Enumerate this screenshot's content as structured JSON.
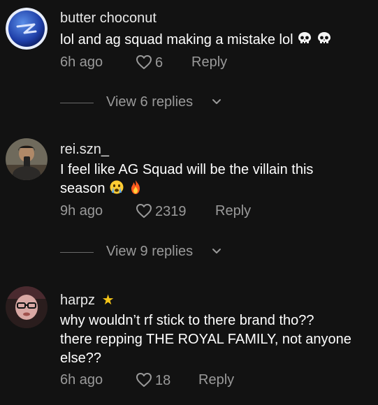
{
  "comments": [
    {
      "username": "butter choconut",
      "text": "lol and ag squad making a mistake lol",
      "time": "6h ago",
      "likes": "6",
      "reply_label": "Reply",
      "view_replies": "View 6 replies",
      "avatar_icon": "blue-sphere-logo"
    },
    {
      "username": "rei.szn_",
      "text_line1": "I feel like AG Squad will be the villain this",
      "text_line2": "season",
      "time": "9h ago",
      "likes": "2319",
      "reply_label": "Reply",
      "view_replies": "View 9 replies",
      "avatar_icon": "user-photo"
    },
    {
      "username": "harpz",
      "badge": "★",
      "text_line1": "why wouldn’t rf stick to there brand tho??",
      "text_line2": "there repping THE ROYAL FAMILY, not anyone",
      "text_line3": "else??",
      "time": "6h ago",
      "likes": "18",
      "reply_label": "Reply",
      "avatar_icon": "user-photo"
    }
  ],
  "colors": {
    "background": "#121212",
    "muted": "#9a9a9a",
    "text": "#ffffff",
    "star": "#f5c518"
  }
}
